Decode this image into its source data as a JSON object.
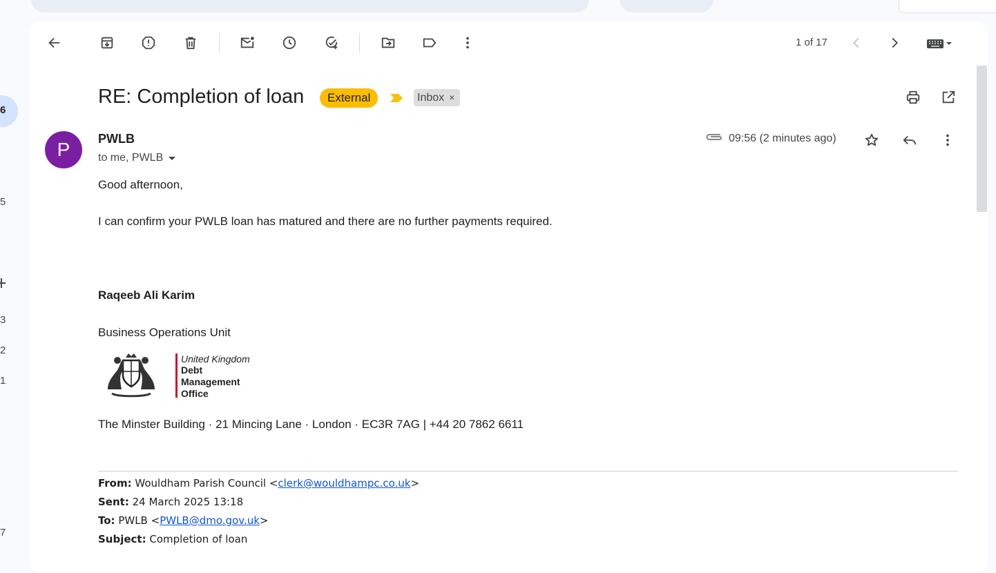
{
  "rail": {
    "active_count": "6",
    "counts": [
      "5",
      "3",
      "2",
      "1",
      "7"
    ]
  },
  "toolbar": {
    "pager_text": "1 of 17",
    "icons": [
      "back-icon",
      "archive-icon",
      "report-spam-icon",
      "delete-icon",
      "mark-unread-icon",
      "snooze-icon",
      "add-task-icon",
      "move-to-icon",
      "label-icon",
      "more-vert-icon",
      "prev-icon",
      "next-icon",
      "keyboard-icon"
    ]
  },
  "message": {
    "subject": "RE: Completion of loan",
    "external_label": "External",
    "inbox_label": "Inbox",
    "inbox_remove": "×",
    "avatar_letter": "P",
    "sender_name": "PWLB",
    "recipients": "to me, PWLB",
    "time": "09:56 (2 minutes ago)"
  },
  "body": {
    "greeting": "Good afternoon,",
    "line1": "I can confirm your PWLB loan has matured and there are no further payments required.",
    "sig_name": "Raqeeb Ali Karim",
    "sig_unit": "Business Operations Unit",
    "logo_line1": "United Kingdom",
    "logo_line2": "Debt",
    "logo_line3": "Management",
    "logo_line4": "Office",
    "address": "The Minster Building · 21 Mincing Lane · London · EC3R 7AG | +44 20 7862 6611"
  },
  "quote": {
    "from_label": "From:",
    "from_name": "Wouldham Parish Council <",
    "from_email": "clerk@wouldhampc.co.uk",
    "from_close": ">",
    "sent_label": "Sent:",
    "sent_value": "24 March 2025 13:18",
    "to_label": "To:",
    "to_name": "PWLB <",
    "to_email": "PWLB@dmo.gov.uk",
    "to_close": ">",
    "subject_label": "Subject:",
    "subject_value": "Completion of loan"
  },
  "colors": {
    "external_badge": "#fbbc04",
    "avatar": "#7b1fa2",
    "link": "#1155cc",
    "logo_rule": "#c8102e"
  }
}
